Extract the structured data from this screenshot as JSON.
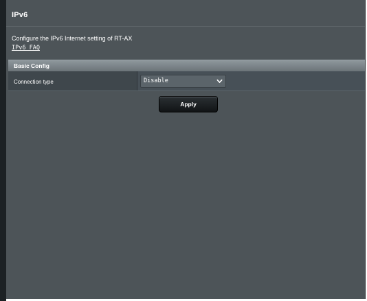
{
  "page": {
    "title": "IPv6",
    "description": "Configure the IPv6 Internet setting of RT-AX",
    "faq_link": "IPv6 FAQ"
  },
  "basic_config": {
    "section_title": "Basic Config",
    "rows": [
      {
        "label": "Connection type",
        "value": "Disable"
      }
    ]
  },
  "actions": {
    "apply_label": "Apply"
  },
  "icons": {
    "dropdown": "chevron-down-icon"
  },
  "colors": {
    "panel_background": "#4d5458",
    "section_header": "#7c858a",
    "button": "#1a1e20",
    "text": "#ffffff"
  }
}
